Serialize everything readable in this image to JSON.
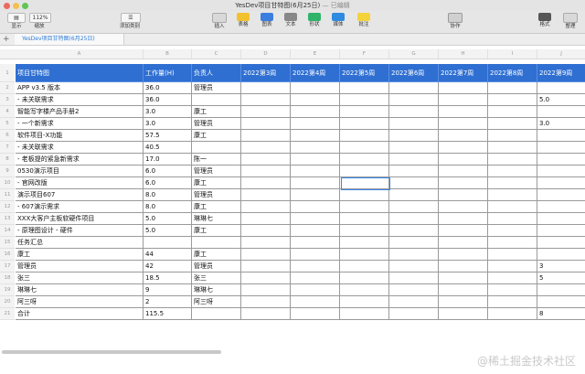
{
  "window": {
    "title": "YesDev项目甘特图(6月25日)",
    "subtitle": "— 已编辑"
  },
  "toolbar": {
    "view_label": "显示",
    "zoom_value": "112%",
    "zoom_label": "缩放",
    "addcat_label": "添加类别",
    "insert_label": "插入",
    "table_label": "表格",
    "chart_label": "图表",
    "text_label": "文本",
    "shape_label": "形状",
    "media_label": "媒体",
    "comment_label": "批注",
    "collab_label": "协作",
    "format_label": "格式",
    "organize_label": "整理",
    "colors": {
      "table": "#f2c12e",
      "chart": "#3c7de0",
      "shape": "#2fb36a",
      "media": "#2e8be0",
      "comment": "#f4d23a"
    }
  },
  "sheet_tab": "YesDev项目甘特图(6月25日)",
  "column_letters": [
    "A",
    "B",
    "C",
    "D",
    "E",
    "F",
    "G",
    "H",
    "I",
    "J"
  ],
  "header_row": [
    "项目甘特图",
    "工作量(H)",
    "负责人",
    "2022第3周",
    "2022第4周",
    "2022第5周",
    "2022第6周",
    "2022第7周",
    "2022第8周",
    "2022第9周"
  ],
  "rows": [
    [
      "APP v3.5 版本",
      "36.0",
      "管理员",
      "",
      "",
      "",
      "",
      "",
      "",
      ""
    ],
    [
      "- 未关联需求",
      "36.0",
      "",
      "",
      "",
      "",
      "",
      "",
      "",
      "5.0"
    ],
    [
      "智能写字楼产品手册2",
      "3.0",
      "康工",
      "",
      "",
      "",
      "",
      "",
      "",
      ""
    ],
    [
      "- 一个新需求",
      "3.0",
      "管理员",
      "",
      "",
      "",
      "",
      "",
      "",
      "3.0"
    ],
    [
      "软件项目-X功能",
      "57.5",
      "康工",
      "",
      "",
      "",
      "",
      "",
      "",
      ""
    ],
    [
      "- 未关联需求",
      "40.5",
      "",
      "",
      "",
      "",
      "",
      "",
      "",
      ""
    ],
    [
      "- 老板提的紧急新需求",
      "17.0",
      "陈一",
      "",
      "",
      "",
      "",
      "",
      "",
      ""
    ],
    [
      "0530演示项目",
      "6.0",
      "管理员",
      "",
      "",
      "",
      "",
      "",
      "",
      ""
    ],
    [
      "- 官网改版",
      "6.0",
      "康工",
      "",
      "",
      "",
      "",
      "",
      "",
      ""
    ],
    [
      "演示项目607",
      "8.0",
      "管理员",
      "",
      "",
      "",
      "",
      "",
      "",
      ""
    ],
    [
      "- 607演示需求",
      "8.0",
      "康工",
      "",
      "",
      "",
      "",
      "",
      "",
      ""
    ],
    [
      "XXX大客户主板软硬件项目",
      "5.0",
      "琳琳七",
      "",
      "",
      "",
      "",
      "",
      "",
      ""
    ],
    [
      "- 原理图设计 - 硬件",
      "5.0",
      "康工",
      "",
      "",
      "",
      "",
      "",
      "",
      ""
    ],
    [
      "任务汇总",
      "",
      "",
      "",
      "",
      "",
      "",
      "",
      "",
      ""
    ],
    [
      "康工",
      "44",
      "康工",
      "",
      "",
      "",
      "",
      "",
      "",
      ""
    ],
    [
      "管理员",
      "42",
      "管理员",
      "",
      "",
      "",
      "",
      "",
      "",
      "3"
    ],
    [
      "张三",
      "18.5",
      "张三",
      "",
      "",
      "",
      "",
      "",
      "",
      "5"
    ],
    [
      "琳琳七",
      "9",
      "琳琳七",
      "",
      "",
      "",
      "",
      "",
      "",
      ""
    ],
    [
      "阿三呀",
      "2",
      "阿三呀",
      "",
      "",
      "",
      "",
      "",
      "",
      ""
    ],
    [
      "合计",
      "115.5",
      "",
      "",
      "",
      "",
      "",
      "",
      "",
      "8"
    ]
  ],
  "watermark": "@稀土掘金技术社区"
}
